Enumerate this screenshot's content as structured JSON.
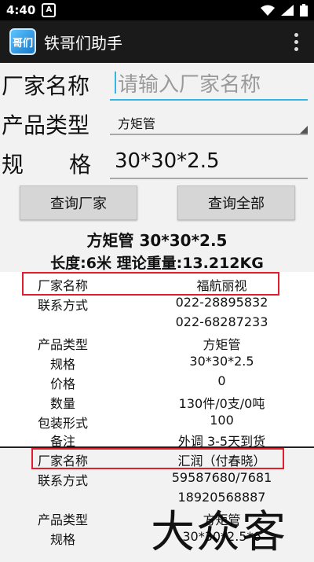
{
  "status": {
    "time": "4:40",
    "notif_icon": "A"
  },
  "app": {
    "title": "铁哥们助手",
    "icon_text": "哥们"
  },
  "form": {
    "vendor_label": "厂家名称",
    "vendor_placeholder": "请输入厂家名称",
    "type_label": "产品类型",
    "type_value": "方矩管",
    "spec_label_1": "规",
    "spec_label_2": "格",
    "spec_value": "30*30*2.5"
  },
  "buttons": {
    "query_vendor": "查询厂家",
    "query_all": "查询全部"
  },
  "summary": {
    "title": "方矩管 30*30*2.5",
    "sub": "长度:6米 理论重量:13.212KG"
  },
  "records": [
    {
      "vendor_label": "厂家名称",
      "vendor": "福航丽视",
      "contact_label": "联系方式",
      "contact1": "022-28895832",
      "contact2": "022-68287233",
      "type_label": "产品类型",
      "type": "方矩管",
      "spec_label": "规格",
      "spec": "30*30*2.5",
      "price_label": "价格",
      "price": "0",
      "qty_label": "数量",
      "qty": "130件/0支/0吨",
      "pack_label": "包装形式",
      "pack": "100",
      "note_label": "备注",
      "note": "外调 3-5天到货"
    },
    {
      "vendor_label": "厂家名称",
      "vendor": "汇润（付春晓）",
      "contact_label": "联系方式",
      "contact1": "59587680/7681",
      "contact2": "18920568887",
      "type_label": "产品类型",
      "type": "方矩管",
      "spec_label": "规格",
      "spec": "30*30*2.5*6"
    }
  ],
  "watermark": "大众客",
  "colors": {
    "accent": "#33b5e5",
    "highlight": "#e21e2b",
    "actionbar": "#1a1a1a"
  }
}
